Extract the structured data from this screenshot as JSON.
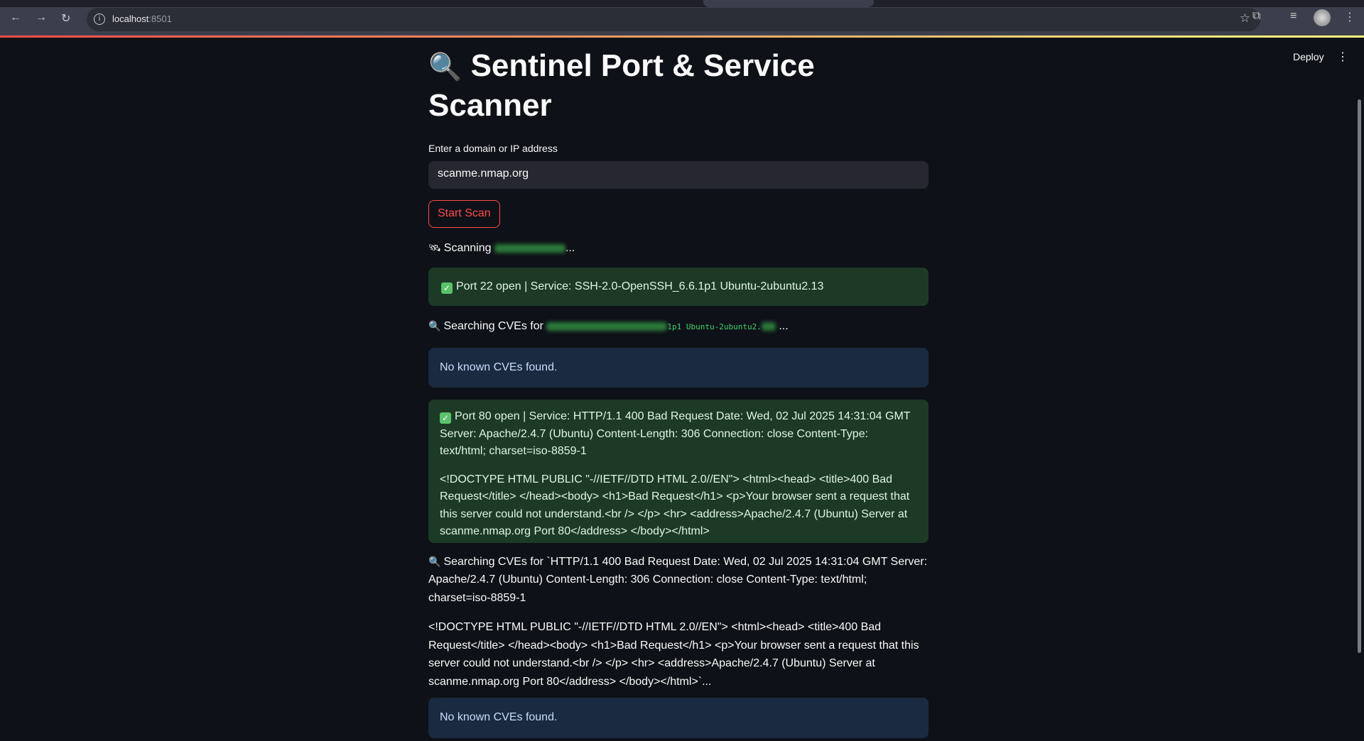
{
  "browser": {
    "url_host": "localhost",
    "url_port": ":8501"
  },
  "header": {
    "deploy_label": "Deploy"
  },
  "title": {
    "emoji": "🔍",
    "text": "Sentinel Port & Service Scanner"
  },
  "input": {
    "label": "Enter a domain or IP address",
    "value": "scanme.nmap.org"
  },
  "button": {
    "label": "Start Scan"
  },
  "log": {
    "scanning_prefix": "Scanning",
    "ellipsis": "...",
    "port22": "Port 22 open | Service: SSH-2.0-OpenSSH_6.6.1p1 Ubuntu-2ubuntu2.13",
    "search1_prefix": "Searching CVEs for",
    "search1_code_visible": "1p1 Ubuntu-2ubuntu2.",
    "no_cves": "No known CVEs found.",
    "port80_line1": "Port 80 open | Service: HTTP/1.1 400 Bad Request Date: Wed, 02 Jul 2025 14:31:04 GMT Server: Apache/2.4.7 (Ubuntu) Content-Length: 306 Connection: close Content-Type: text/html; charset=iso-8859-1",
    "port80_body": "<!DOCTYPE HTML PUBLIC \"-//IETF//DTD HTML 2.0//EN\"> <html><head> <title>400 Bad Request</title> </head><body> <h1>Bad Request</h1> <p>Your browser sent a request that this server could not understand.<br /> </p> <hr> <address>Apache/2.4.7 (Ubuntu) Server at scanme.nmap.org Port 80</address> </body></html>",
    "search2_line1": "Searching CVEs for `HTTP/1.1 400 Bad Request Date: Wed, 02 Jul 2025 14:31:04 GMT Server: Apache/2.4.7 (Ubuntu) Content-Length: 306 Connection: close Content-Type: text/html; charset=iso-8859-1",
    "search2_body": "<!DOCTYPE HTML PUBLIC \"-//IETF//DTD HTML 2.0//EN\"> <html><head> <title>400 Bad Request</title> </head><body> <h1>Bad Request</h1> <p>Your browser sent a request that this server could not understand.<br /> </p> <hr> <address>Apache/2.4.7 (Ubuntu) Server at scanme.nmap.org Port 80</address> </body></html>`...",
    "no_cves_2": "No known CVEs found."
  },
  "colors": {
    "accent": "#ff4b4b",
    "success_bg": "#1d3a27",
    "info_bg": "#1a2a40",
    "bg": "#0e1117"
  }
}
